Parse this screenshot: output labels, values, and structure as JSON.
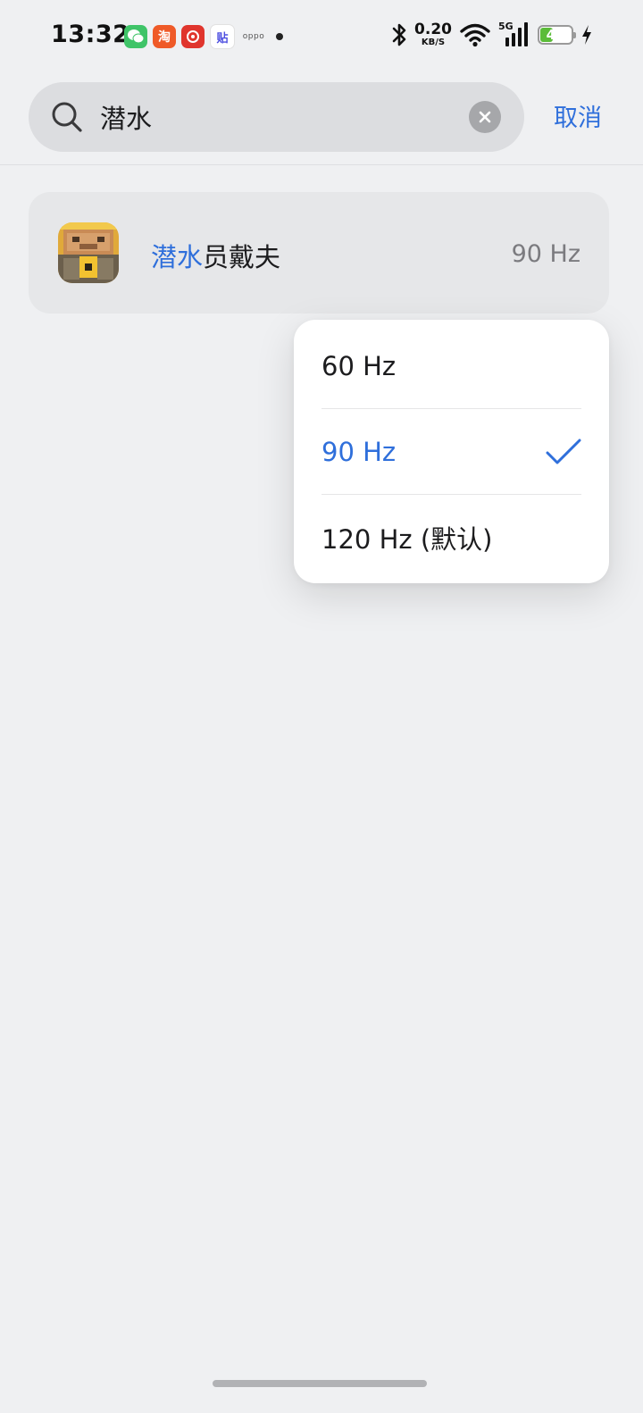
{
  "status_bar": {
    "time": "13:32",
    "notifications": [
      {
        "name": "wechat-icon",
        "glyph": "◉"
      },
      {
        "name": "taobao-icon",
        "glyph": "淘"
      },
      {
        "name": "netease-music-icon",
        "glyph": "◎"
      },
      {
        "name": "tieba-icon",
        "glyph": "贴"
      },
      {
        "name": "oppo-icon",
        "glyph": "oppo"
      }
    ],
    "net_speed_value": "0.20",
    "net_speed_unit": "KB/S",
    "network_type": "5G",
    "battery_level": "40",
    "battery_fraction": 0.4,
    "charging": true
  },
  "search": {
    "query": "潜水",
    "cancel_label": "取消"
  },
  "result": {
    "app_name_highlight": "潜水",
    "app_name_rest": "员戴夫",
    "refresh_rate": "90 Hz"
  },
  "menu": {
    "options": [
      {
        "label": "60 Hz",
        "selected": false
      },
      {
        "label": "90 Hz",
        "selected": true
      },
      {
        "label": "120 Hz (默认)",
        "selected": false
      }
    ]
  },
  "colors": {
    "accent": "#2f6fdb",
    "background": "#eff0f2",
    "battery": "#5bbc39"
  }
}
